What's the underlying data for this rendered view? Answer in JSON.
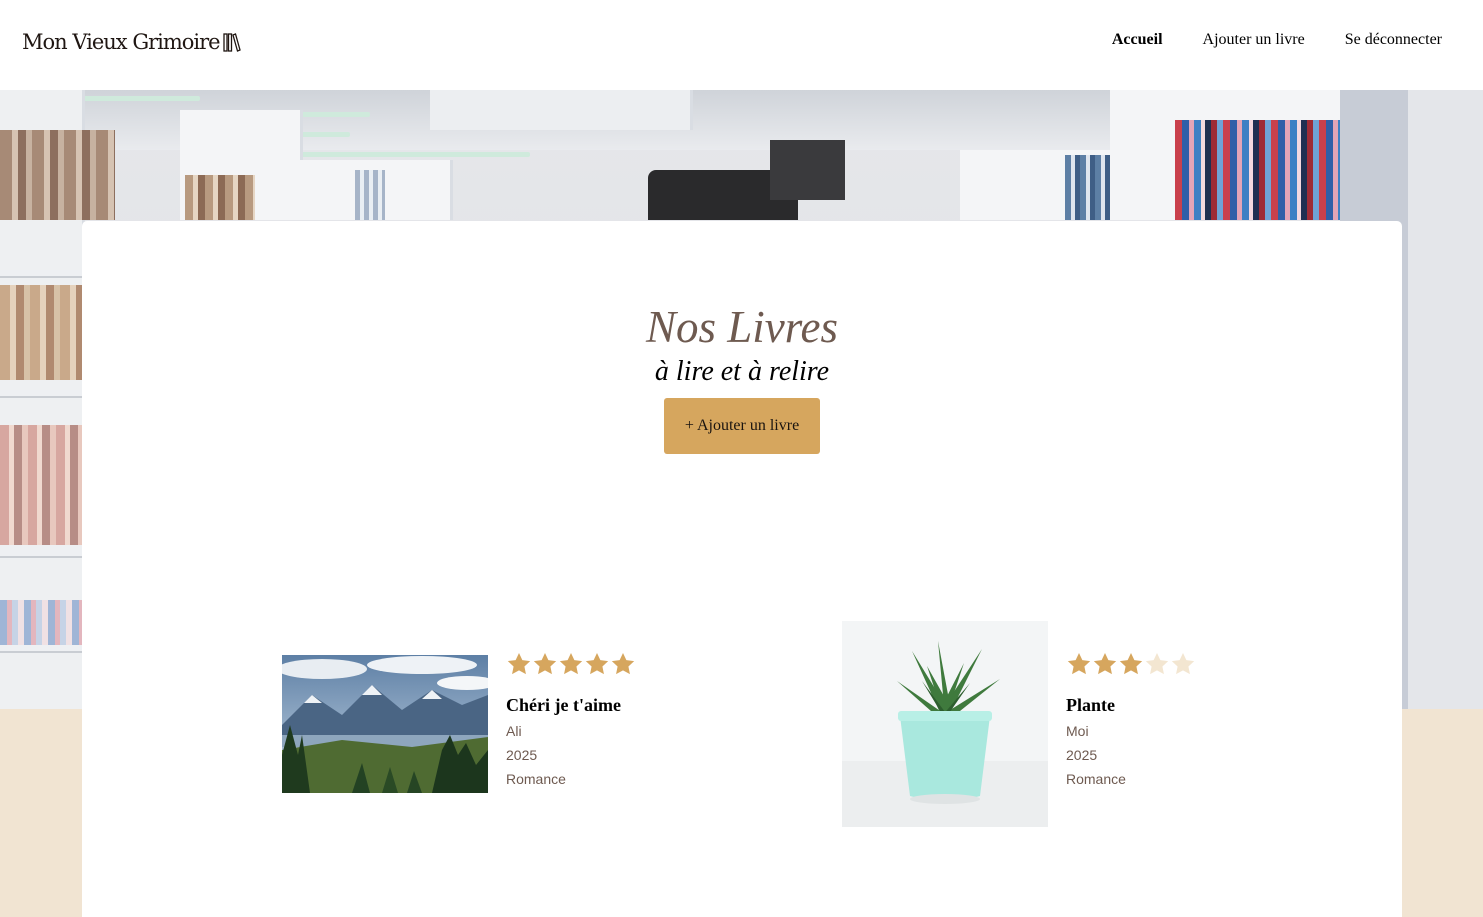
{
  "header": {
    "logo_text": "Mon Vieux Grimoire",
    "nav": [
      {
        "label": "Accueil",
        "active": true
      },
      {
        "label": "Ajouter un livre",
        "active": false
      },
      {
        "label": "Se déconnecter",
        "active": false
      }
    ]
  },
  "main": {
    "title": "Nos Livres",
    "subtitle": "à lire et à relire",
    "add_button_label": "+ Ajouter un livre"
  },
  "books": [
    {
      "title": "Chéri je t'aime",
      "author": "Ali",
      "year": "2025",
      "genre": "Romance",
      "rating": 5,
      "cover": "mountain-landscape-image"
    },
    {
      "title": "Plante",
      "author": "Moi",
      "year": "2025",
      "genre": "Romance",
      "rating": 3,
      "cover": "potted-succulent-image"
    }
  ],
  "colors": {
    "accent": "#d6a65e",
    "star_filled": "#d6a65e",
    "star_empty": "#f3e6d1",
    "title_brown": "#6e5a50",
    "page_background": "#f1e4d2"
  }
}
